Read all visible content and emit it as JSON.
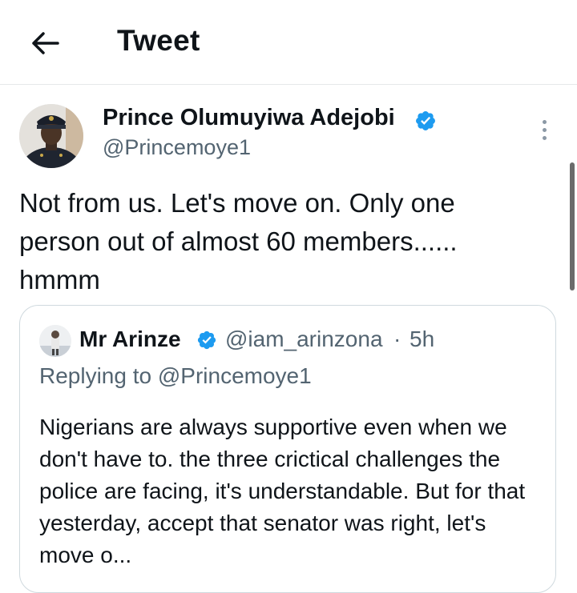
{
  "header": {
    "title": "Tweet",
    "back_icon": "arrow-left-icon"
  },
  "tweet": {
    "author_name": "Prince Olumuyiwa Adejobi",
    "author_handle": "@Princemoye1",
    "verified_icon": "verified-badge-icon",
    "more_icon": "more-vertical-icon",
    "text": "Not from us. Let's move on. Only one person out of almost 60 members...... hmmm"
  },
  "quote": {
    "author_name": "Mr Arinze",
    "author_handle": "@iam_arinzona",
    "separator": "·",
    "time": "5h",
    "replying_to": "Replying to @Princemoye1",
    "text": "Nigerians are always supportive even when we don't have to. the three crictical challenges the police are facing, it's understandable. But for that yesterday, accept that senator was right, let's move o..."
  },
  "colors": {
    "accent": "#1d9bf0",
    "text_primary": "#0f1419",
    "text_secondary": "#536471",
    "border": "#cfd9de"
  }
}
